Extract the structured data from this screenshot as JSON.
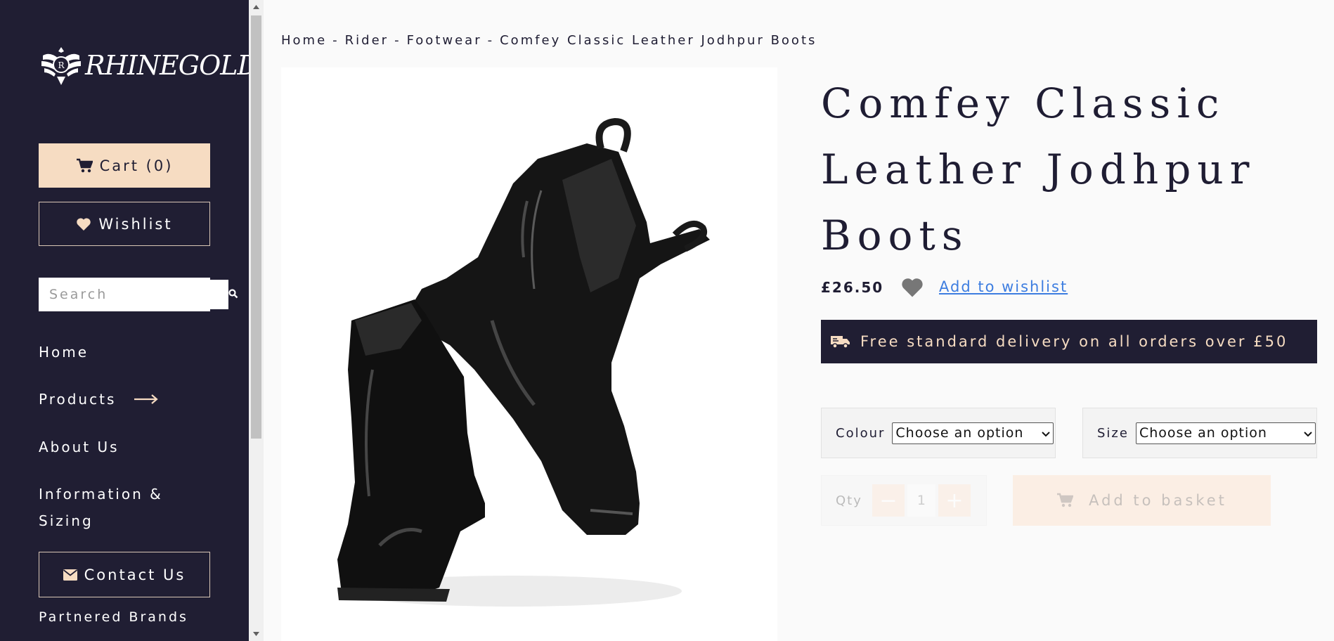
{
  "sidebar": {
    "logo_text": "RHINEGOLD",
    "cart_label": "Cart (0)",
    "wishlist_label": "Wishlist",
    "search_placeholder": "Search",
    "nav": {
      "home": "Home",
      "products": "Products",
      "about": "About Us",
      "information": "Information & Sizing",
      "partners": "Partnered Brands"
    },
    "contact_label": "Contact Us"
  },
  "breadcrumb": [
    "Home",
    "Rider",
    "Footwear",
    "Comfey Classic Leather Jodhpur Boots"
  ],
  "breadcrumb_separator": "-",
  "product": {
    "title": "Comfey Classic Leather Jodhpur Boots",
    "price": "£26.50",
    "wishlist_link": "Add to wishlist",
    "delivery_text": "Free standard delivery on all orders over £50",
    "colour_label": "Colour",
    "colour_value": "Choose an option",
    "size_label": "Size",
    "size_value": "Choose an option",
    "qty_label": "Qty",
    "qty_value": "1",
    "qty_minus": "−",
    "qty_plus": "+",
    "add_to_basket": "Add to basket"
  },
  "colors": {
    "sidebar_bg": "#201e33",
    "accent_peach": "#f6dcc2",
    "link_blue": "#3d7de0"
  },
  "icons": [
    "cart-icon",
    "heart-icon",
    "search-icon",
    "arrow-right-icon",
    "envelope-icon",
    "truck-icon",
    "chevron-down-icon"
  ]
}
